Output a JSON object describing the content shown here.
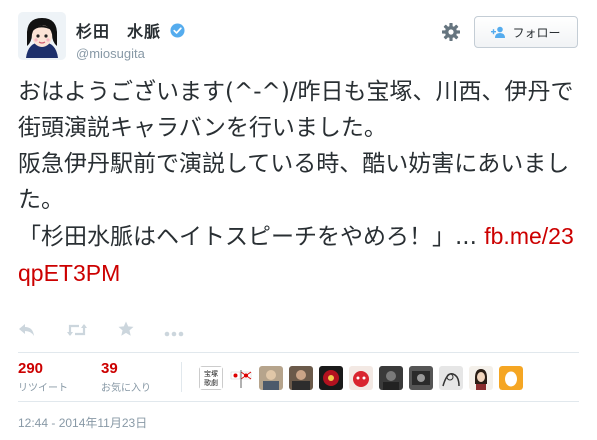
{
  "user": {
    "display_name": "杉田　水脈",
    "handle": "@miosugita",
    "verified": true
  },
  "follow_button": {
    "label": "フォロー",
    "icon": "person-add-icon"
  },
  "header_icons": {
    "settings": "gear-icon"
  },
  "tweet": {
    "text": "おはようございます(^-^)/昨日も宝塚、川西、伊丹で街頭演説キャラバンを行いました。\n阪急伊丹駅前で演説している時、酷い妨害にあいました。\n「杉田水脈はヘイトスピーチをやめろ！」... ",
    "link": "fb.me/23qpET3PM"
  },
  "actions": [
    "reply-icon",
    "retweet-icon",
    "favorite-icon",
    "more-icon"
  ],
  "stats": {
    "retweets": {
      "count": "290",
      "label": "リツイート"
    },
    "favorites": {
      "count": "39",
      "label": "お気に入り"
    }
  },
  "favoriters": [
    {
      "name": "avatar-kanji-stamp",
      "text": "宝塚\n歌劇"
    },
    {
      "name": "avatar-flags"
    },
    {
      "name": "avatar-photo-1"
    },
    {
      "name": "avatar-photo-2"
    },
    {
      "name": "avatar-red-emblem"
    },
    {
      "name": "avatar-red-character"
    },
    {
      "name": "avatar-dark-photo-1"
    },
    {
      "name": "avatar-dark-photo-2"
    },
    {
      "name": "avatar-sketch"
    },
    {
      "name": "avatar-portrait"
    },
    {
      "name": "avatar-default-egg"
    }
  ],
  "timestamp": "12:44 - 2014年11月23日",
  "colors": {
    "accent": "#cc0000",
    "muted": "#8899a6",
    "text": "#292f33",
    "verified": "#55acee"
  }
}
